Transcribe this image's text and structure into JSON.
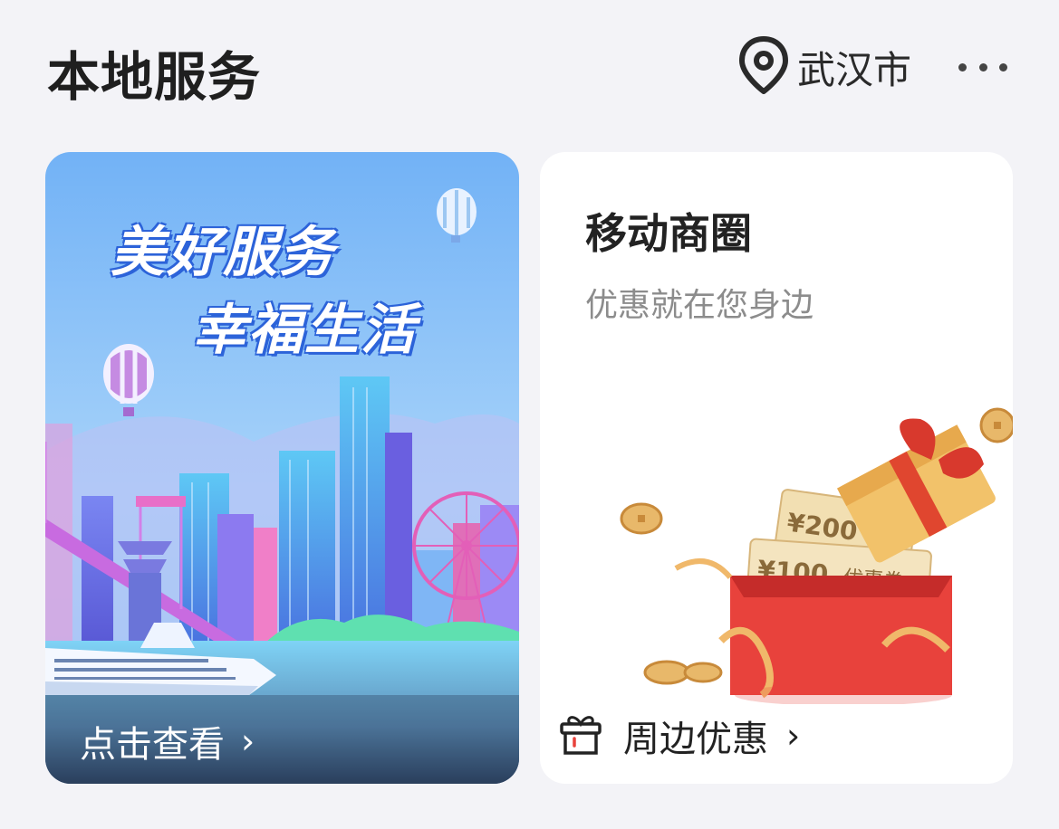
{
  "header": {
    "title": "本地服务",
    "location": "武汉市",
    "icons": {
      "location": "location-pin-icon",
      "more": "more-dots-icon"
    }
  },
  "left_card": {
    "slogan_line1": "美好服务",
    "slogan_line2": "幸福生活",
    "cta": "点击查看",
    "chevron": "›"
  },
  "right_card": {
    "title": "移动商圈",
    "subtitle": "优惠就在您身边",
    "coupon_200": "¥200",
    "coupon_100": "¥100",
    "coupon_label": "优惠券",
    "cta": "周边优惠",
    "chevron": "›",
    "icon": "gift-icon"
  },
  "colors": {
    "background": "#f3f3f7",
    "sky_top": "#7ab8f7",
    "sky_bottom": "#c9e6fb",
    "gift_red": "#e8423c",
    "gold": "#e8b86a"
  }
}
